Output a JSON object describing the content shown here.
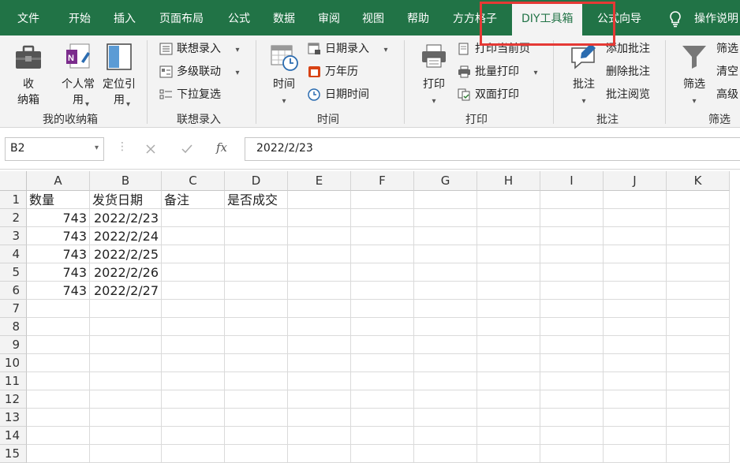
{
  "tabs": [
    "文件",
    "开始",
    "插入",
    "页面布局",
    "公式",
    "数据",
    "审阅",
    "视图",
    "帮助",
    "方方格子",
    "DIY工具箱",
    "公式向导",
    "操作说明"
  ],
  "active_tab": "DIY工具箱",
  "ribbon": {
    "groups": {
      "storage": "我的收纳箱",
      "linked": "联想录入",
      "time": "时间",
      "print": "打印",
      "comment": "批注",
      "filter": "筛选"
    },
    "storage": {
      "box_label": "收\n纳箱",
      "personal_label": "个人常\n用",
      "locate_label": "定位引\n用"
    },
    "linked": {
      "item1": "联想录入",
      "item2": "多级联动",
      "item3": "下拉复选"
    },
    "time": {
      "big_label": "时间",
      "item1": "日期录入",
      "item2": "万年历",
      "item3": "日期时间"
    },
    "print": {
      "big_label": "打印",
      "item1": "打印当前页",
      "item2": "批量打印",
      "item3": "双面打印"
    },
    "comment": {
      "big_label": "批注",
      "item1": "添加批注",
      "item2": "删除批注",
      "item3": "批注阅览"
    },
    "filter": {
      "big_label": "筛选",
      "item1": "筛选",
      "item2": "清空",
      "item3": "高级"
    }
  },
  "formula_bar": {
    "cell_ref": "B2",
    "fx": "fx",
    "value": "2022/2/23"
  },
  "columns": [
    "A",
    "B",
    "C",
    "D",
    "E",
    "F",
    "G",
    "H",
    "I",
    "J",
    "K"
  ],
  "rows": [
    "1",
    "2",
    "3",
    "4",
    "5",
    "6",
    "7",
    "8",
    "9",
    "10",
    "11",
    "12",
    "13",
    "14",
    "15"
  ],
  "sheet": {
    "headers": [
      "数量",
      "发货日期",
      "备注",
      "是否成交"
    ],
    "data": [
      [
        "743",
        "2022/2/23"
      ],
      [
        "743",
        "2022/2/24"
      ],
      [
        "743",
        "2022/2/25"
      ],
      [
        "743",
        "2022/2/26"
      ],
      [
        "743",
        "2022/2/27"
      ]
    ]
  },
  "colors": {
    "brand": "#217346",
    "highlight": "#e53935"
  }
}
